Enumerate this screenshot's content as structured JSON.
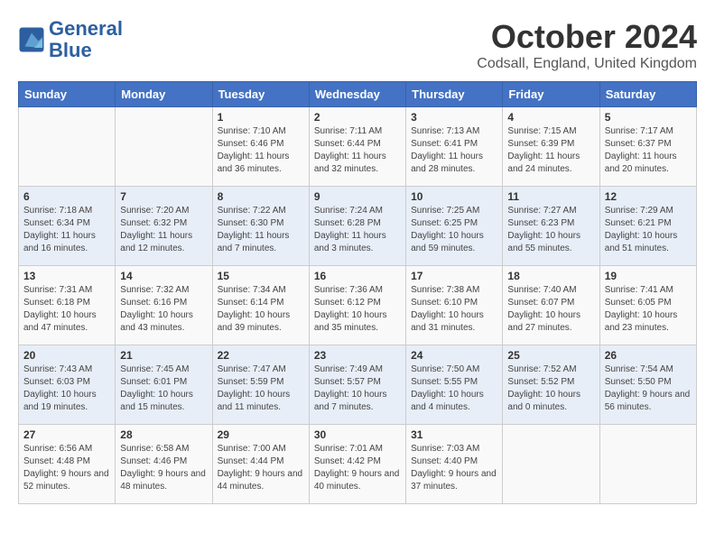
{
  "logo": {
    "line1": "General",
    "line2": "Blue"
  },
  "title": "October 2024",
  "location": "Codsall, England, United Kingdom",
  "headers": [
    "Sunday",
    "Monday",
    "Tuesday",
    "Wednesday",
    "Thursday",
    "Friday",
    "Saturday"
  ],
  "weeks": [
    [
      {
        "day": "",
        "info": ""
      },
      {
        "day": "",
        "info": ""
      },
      {
        "day": "1",
        "info": "Sunrise: 7:10 AM\nSunset: 6:46 PM\nDaylight: 11 hours\nand 36 minutes."
      },
      {
        "day": "2",
        "info": "Sunrise: 7:11 AM\nSunset: 6:44 PM\nDaylight: 11 hours\nand 32 minutes."
      },
      {
        "day": "3",
        "info": "Sunrise: 7:13 AM\nSunset: 6:41 PM\nDaylight: 11 hours\nand 28 minutes."
      },
      {
        "day": "4",
        "info": "Sunrise: 7:15 AM\nSunset: 6:39 PM\nDaylight: 11 hours\nand 24 minutes."
      },
      {
        "day": "5",
        "info": "Sunrise: 7:17 AM\nSunset: 6:37 PM\nDaylight: 11 hours\nand 20 minutes."
      }
    ],
    [
      {
        "day": "6",
        "info": "Sunrise: 7:18 AM\nSunset: 6:34 PM\nDaylight: 11 hours\nand 16 minutes."
      },
      {
        "day": "7",
        "info": "Sunrise: 7:20 AM\nSunset: 6:32 PM\nDaylight: 11 hours\nand 12 minutes."
      },
      {
        "day": "8",
        "info": "Sunrise: 7:22 AM\nSunset: 6:30 PM\nDaylight: 11 hours\nand 7 minutes."
      },
      {
        "day": "9",
        "info": "Sunrise: 7:24 AM\nSunset: 6:28 PM\nDaylight: 11 hours\nand 3 minutes."
      },
      {
        "day": "10",
        "info": "Sunrise: 7:25 AM\nSunset: 6:25 PM\nDaylight: 10 hours\nand 59 minutes."
      },
      {
        "day": "11",
        "info": "Sunrise: 7:27 AM\nSunset: 6:23 PM\nDaylight: 10 hours\nand 55 minutes."
      },
      {
        "day": "12",
        "info": "Sunrise: 7:29 AM\nSunset: 6:21 PM\nDaylight: 10 hours\nand 51 minutes."
      }
    ],
    [
      {
        "day": "13",
        "info": "Sunrise: 7:31 AM\nSunset: 6:18 PM\nDaylight: 10 hours\nand 47 minutes."
      },
      {
        "day": "14",
        "info": "Sunrise: 7:32 AM\nSunset: 6:16 PM\nDaylight: 10 hours\nand 43 minutes."
      },
      {
        "day": "15",
        "info": "Sunrise: 7:34 AM\nSunset: 6:14 PM\nDaylight: 10 hours\nand 39 minutes."
      },
      {
        "day": "16",
        "info": "Sunrise: 7:36 AM\nSunset: 6:12 PM\nDaylight: 10 hours\nand 35 minutes."
      },
      {
        "day": "17",
        "info": "Sunrise: 7:38 AM\nSunset: 6:10 PM\nDaylight: 10 hours\nand 31 minutes."
      },
      {
        "day": "18",
        "info": "Sunrise: 7:40 AM\nSunset: 6:07 PM\nDaylight: 10 hours\nand 27 minutes."
      },
      {
        "day": "19",
        "info": "Sunrise: 7:41 AM\nSunset: 6:05 PM\nDaylight: 10 hours\nand 23 minutes."
      }
    ],
    [
      {
        "day": "20",
        "info": "Sunrise: 7:43 AM\nSunset: 6:03 PM\nDaylight: 10 hours\nand 19 minutes."
      },
      {
        "day": "21",
        "info": "Sunrise: 7:45 AM\nSunset: 6:01 PM\nDaylight: 10 hours\nand 15 minutes."
      },
      {
        "day": "22",
        "info": "Sunrise: 7:47 AM\nSunset: 5:59 PM\nDaylight: 10 hours\nand 11 minutes."
      },
      {
        "day": "23",
        "info": "Sunrise: 7:49 AM\nSunset: 5:57 PM\nDaylight: 10 hours\nand 7 minutes."
      },
      {
        "day": "24",
        "info": "Sunrise: 7:50 AM\nSunset: 5:55 PM\nDaylight: 10 hours\nand 4 minutes."
      },
      {
        "day": "25",
        "info": "Sunrise: 7:52 AM\nSunset: 5:52 PM\nDaylight: 10 hours\nand 0 minutes."
      },
      {
        "day": "26",
        "info": "Sunrise: 7:54 AM\nSunset: 5:50 PM\nDaylight: 9 hours\nand 56 minutes."
      }
    ],
    [
      {
        "day": "27",
        "info": "Sunrise: 6:56 AM\nSunset: 4:48 PM\nDaylight: 9 hours\nand 52 minutes."
      },
      {
        "day": "28",
        "info": "Sunrise: 6:58 AM\nSunset: 4:46 PM\nDaylight: 9 hours\nand 48 minutes."
      },
      {
        "day": "29",
        "info": "Sunrise: 7:00 AM\nSunset: 4:44 PM\nDaylight: 9 hours\nand 44 minutes."
      },
      {
        "day": "30",
        "info": "Sunrise: 7:01 AM\nSunset: 4:42 PM\nDaylight: 9 hours\nand 40 minutes."
      },
      {
        "day": "31",
        "info": "Sunrise: 7:03 AM\nSunset: 4:40 PM\nDaylight: 9 hours\nand 37 minutes."
      },
      {
        "day": "",
        "info": ""
      },
      {
        "day": "",
        "info": ""
      }
    ]
  ]
}
